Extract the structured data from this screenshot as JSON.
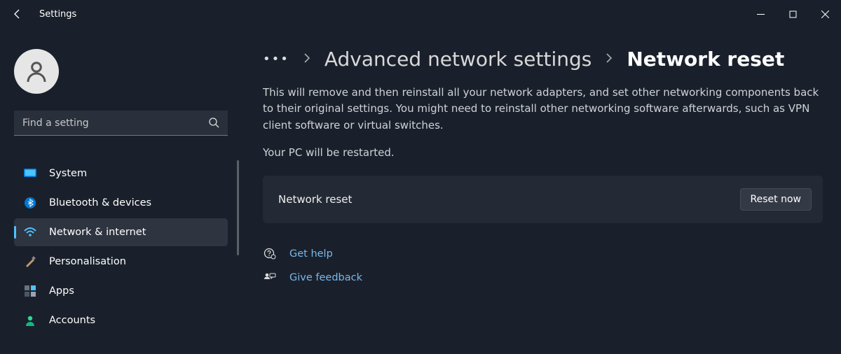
{
  "app_title": "Settings",
  "search": {
    "placeholder": "Find a setting"
  },
  "sidebar": {
    "items": [
      {
        "label": "System"
      },
      {
        "label": "Bluetooth & devices"
      },
      {
        "label": "Network & internet"
      },
      {
        "label": "Personalisation"
      },
      {
        "label": "Apps"
      },
      {
        "label": "Accounts"
      }
    ]
  },
  "breadcrumb": {
    "parent": "Advanced network settings",
    "current": "Network reset"
  },
  "description": "This will remove and then reinstall all your network adapters, and set other networking components back to their original settings. You might need to reinstall other networking software afterwards, such as VPN client software or virtual switches.",
  "restart_note": "Your PC will be restarted.",
  "card": {
    "label": "Network reset",
    "button": "Reset now"
  },
  "links": {
    "help": "Get help",
    "feedback": "Give feedback"
  }
}
